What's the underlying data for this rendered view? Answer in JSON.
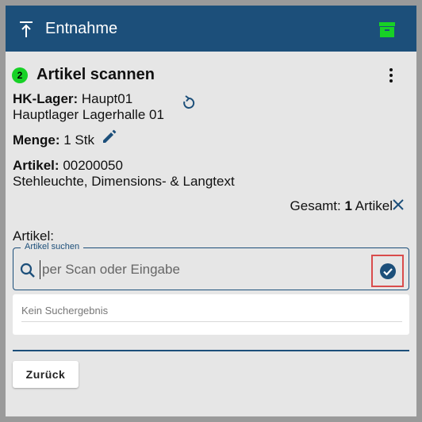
{
  "header": {
    "title": "Entnahme",
    "icon": "upload-arrow-icon",
    "action_icon": "archive-icon",
    "accent_color": "#17d126",
    "bar_color": "#1c4f7a"
  },
  "step": {
    "number": "2",
    "title": "Artikel scannen",
    "menu_icon": "more-vertical-icon"
  },
  "hk_lager": {
    "label": "HK-Lager:",
    "value": "Haupt01",
    "description": "Hauptlager Lagerhalle 01"
  },
  "menge": {
    "label": "Menge:",
    "value": "1 Stk"
  },
  "artikel_info": {
    "label": "Artikel:",
    "value": "00200050",
    "description": "Stehleuchte, Dimensions- & Langtext"
  },
  "total": {
    "label": "Gesamt:",
    "count": "1",
    "unit": "Artikel"
  },
  "search": {
    "field_label": "Artikel:",
    "legend": "Artikel suchen",
    "placeholder": "per Scan oder Eingabe",
    "value": ""
  },
  "results": {
    "empty_text": "Kein Suchergebnis"
  },
  "buttons": {
    "back": "Zurück"
  }
}
